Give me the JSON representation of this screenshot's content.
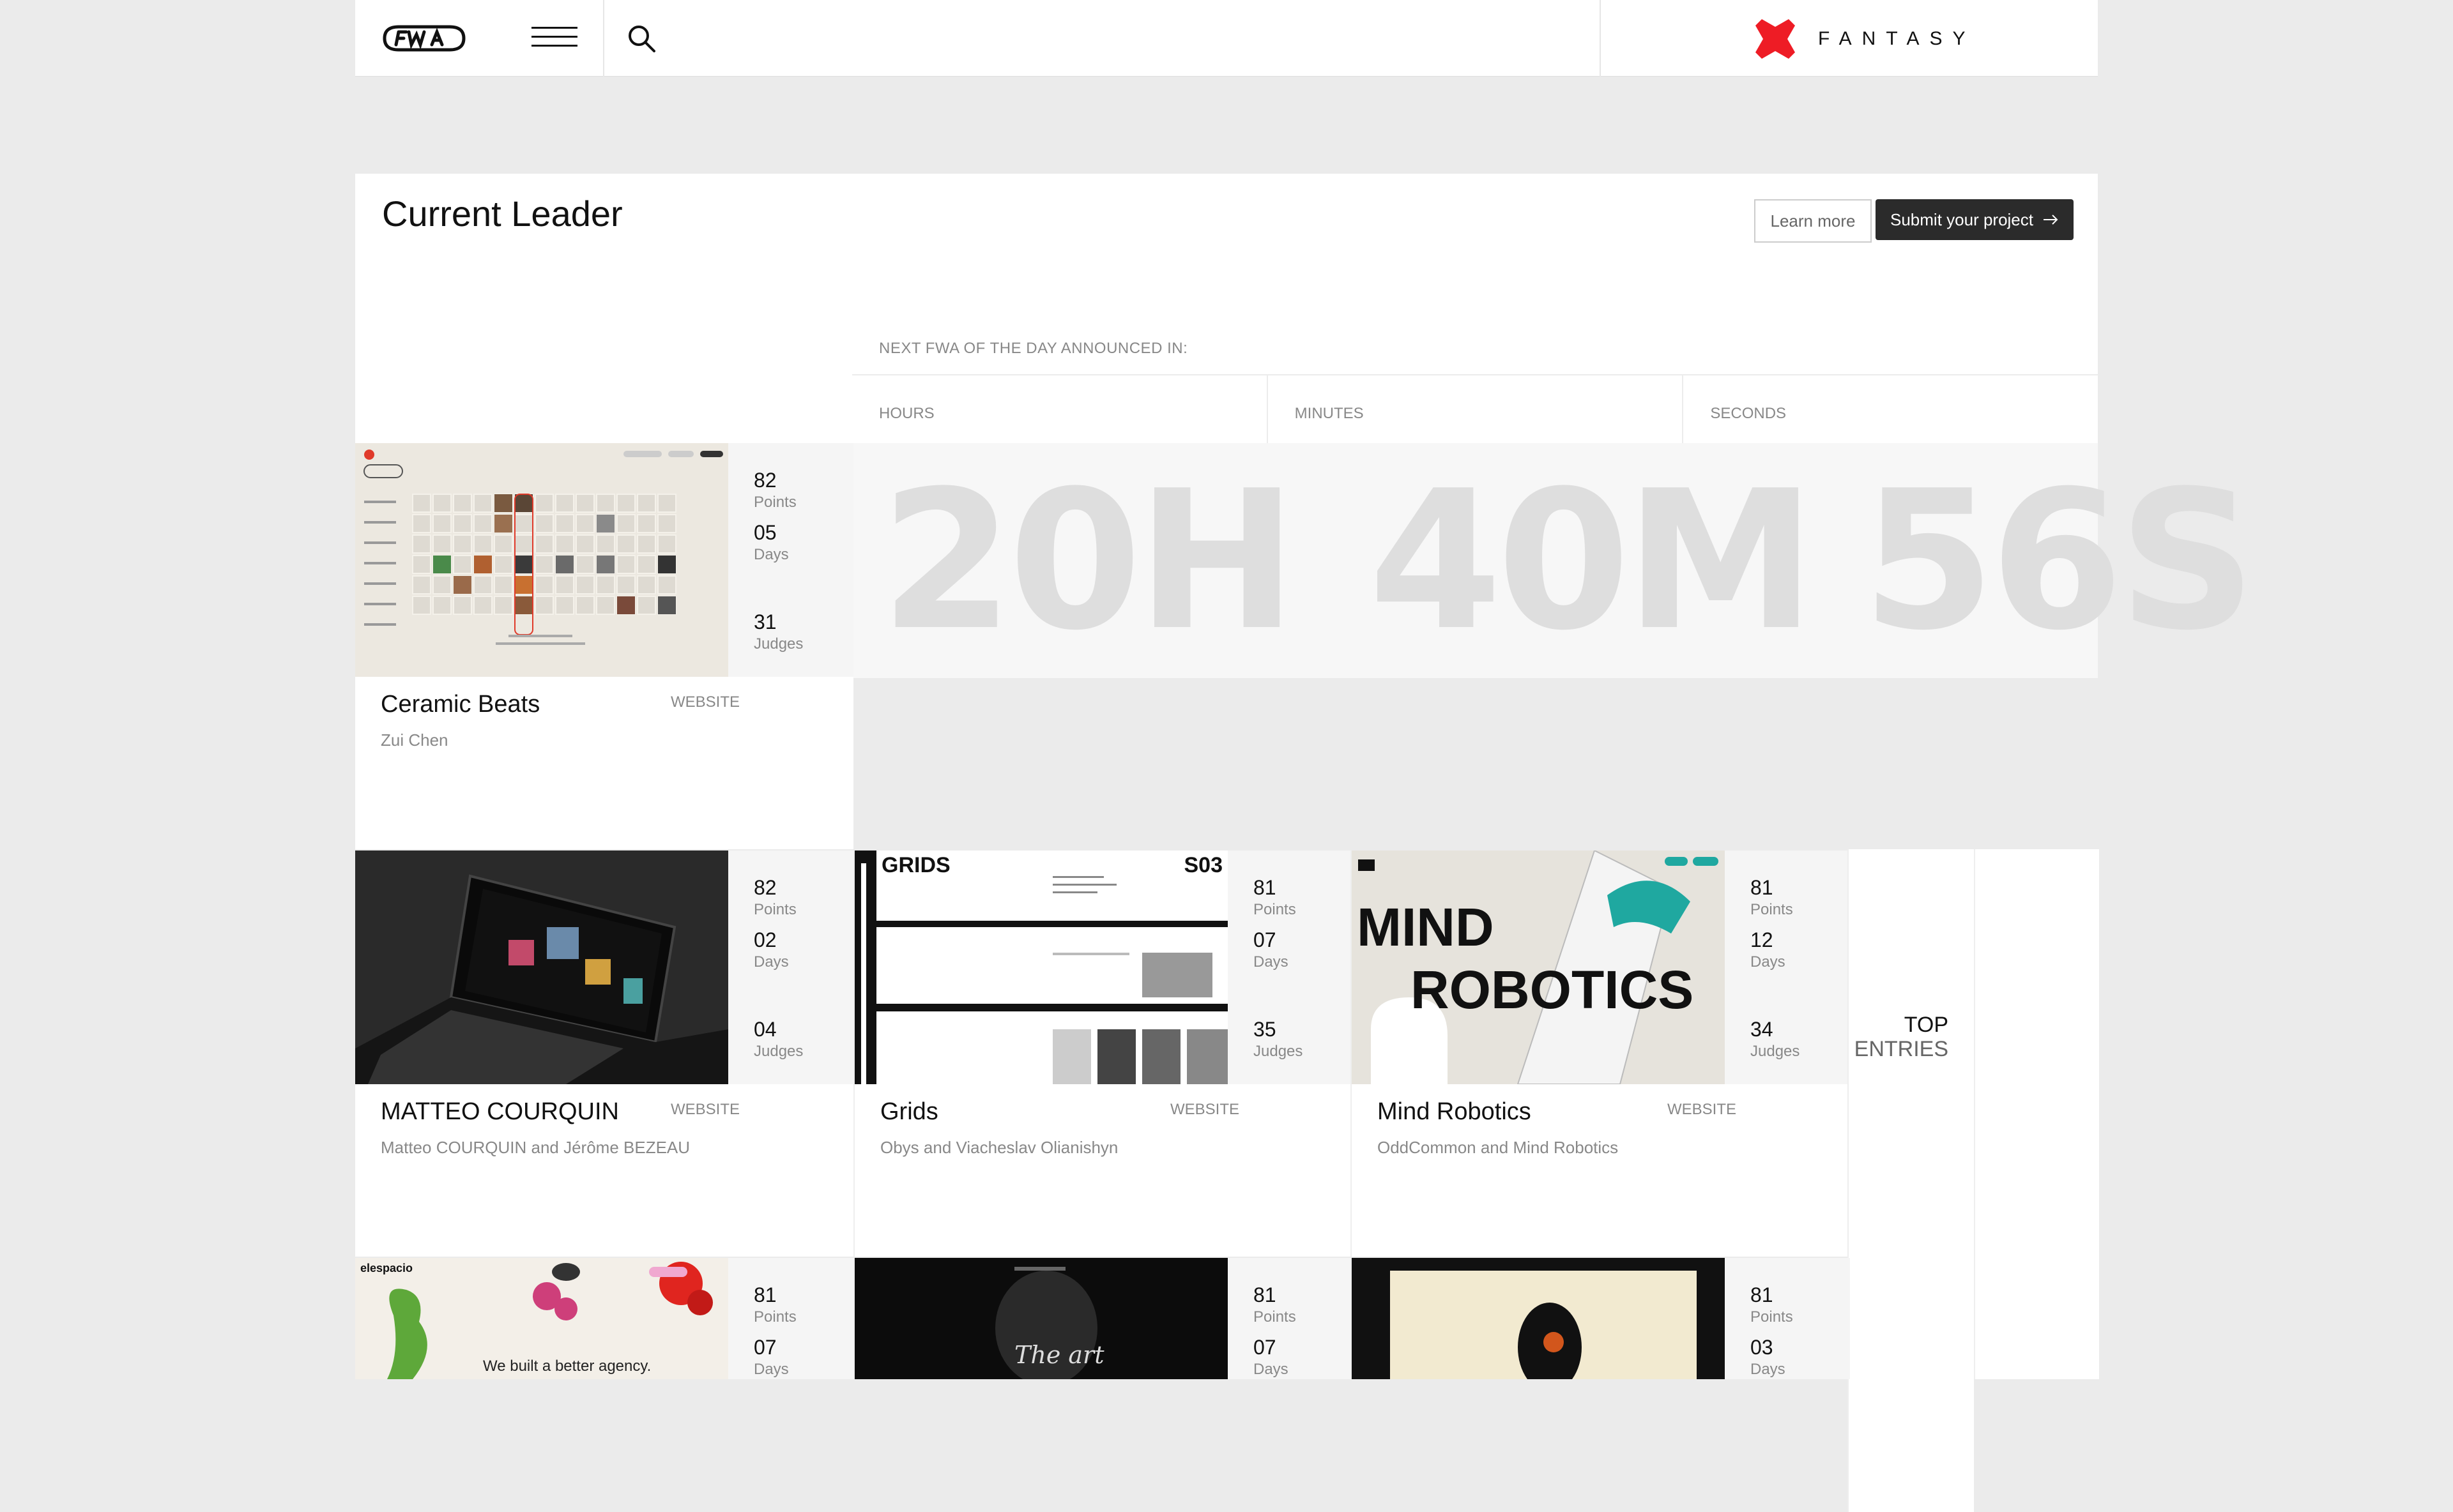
{
  "header": {
    "logo": "FWA",
    "brand": "FANTASY",
    "colors": {
      "brand_red": "#ee1c25"
    }
  },
  "leader": {
    "title": "Current Leader",
    "learn_more": "Learn more",
    "submit": "Submit your project",
    "announce": "NEXT FWA OF THE DAY ANNOUNCED IN:",
    "labels": {
      "hours": "HOURS",
      "minutes": "MINUTES",
      "seconds": "SECONDS"
    },
    "countdown": {
      "hours": "20H",
      "minutes": "40M",
      "seconds": "56S"
    },
    "card": {
      "title": "Ceramic Beats",
      "type": "WEBSITE",
      "author": "Zui Chen",
      "points": "82",
      "points_label": "Points",
      "days": "05",
      "days_label": "Days",
      "judges": "31",
      "judges_label": "Judges"
    }
  },
  "entries": [
    {
      "title": "MATTEO COURQUIN",
      "type": "WEBSITE",
      "author": "Matteo COURQUIN and Jérôme BEZEAU",
      "points": "82",
      "days": "02",
      "judges": "04",
      "points_label": "Points",
      "days_label": "Days",
      "judges_label": "Judges"
    },
    {
      "title": "Grids",
      "type": "WEBSITE",
      "author": "Obys and Viacheslav Olianishyn",
      "points": "81",
      "days": "07",
      "judges": "35",
      "points_label": "Points",
      "days_label": "Days",
      "judges_label": "Judges",
      "thumb_left": "GRIDS",
      "thumb_right": "S03"
    },
    {
      "title": "Mind Robotics",
      "type": "WEBSITE",
      "author": "OddCommon and Mind Robotics",
      "points": "81",
      "days": "12",
      "judges": "34",
      "points_label": "Points",
      "days_label": "Days",
      "judges_label": "Judges",
      "thumb_line1": "MIND",
      "thumb_line2": "ROBOTICS"
    }
  ],
  "row3": [
    {
      "points": "81",
      "days": "07",
      "points_label": "Points",
      "days_label": "Days",
      "thumb_brand": "elespacio",
      "thumb_text": "We built a better agency."
    },
    {
      "points": "81",
      "days": "07",
      "points_label": "Points",
      "days_label": "Days",
      "thumb_text": "The art"
    },
    {
      "points": "81",
      "days": "03",
      "points_label": "Points",
      "days_label": "Days"
    }
  ],
  "top_entries": {
    "line1": "TOP",
    "line2": "ENTRIES"
  }
}
